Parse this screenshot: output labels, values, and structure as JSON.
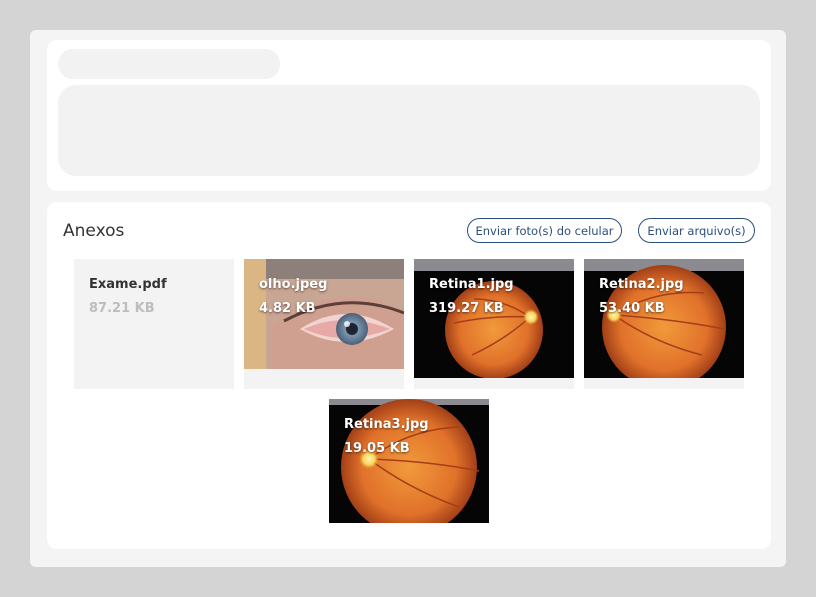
{
  "attachments": {
    "title": "Anexos",
    "btn_phone": "Enviar foto(s) do celular",
    "btn_file": "Enviar arquivo(s)",
    "files": [
      {
        "name": "Exame.pdf",
        "size": "87.21 KB"
      },
      {
        "name": "olho.jpeg",
        "size": "4.82 KB"
      },
      {
        "name": "Retina1.jpg",
        "size": "319.27 KB"
      },
      {
        "name": "Retina2.jpg",
        "size": "53.40 KB"
      },
      {
        "name": "Retina3.jpg",
        "size": "19.05 KB"
      }
    ]
  },
  "colors": {
    "accent": "#2c4f7c",
    "page_bg": "#d4d4d4",
    "panel_bg": "#f4f4f4",
    "skeleton": "#f2f2f2"
  }
}
